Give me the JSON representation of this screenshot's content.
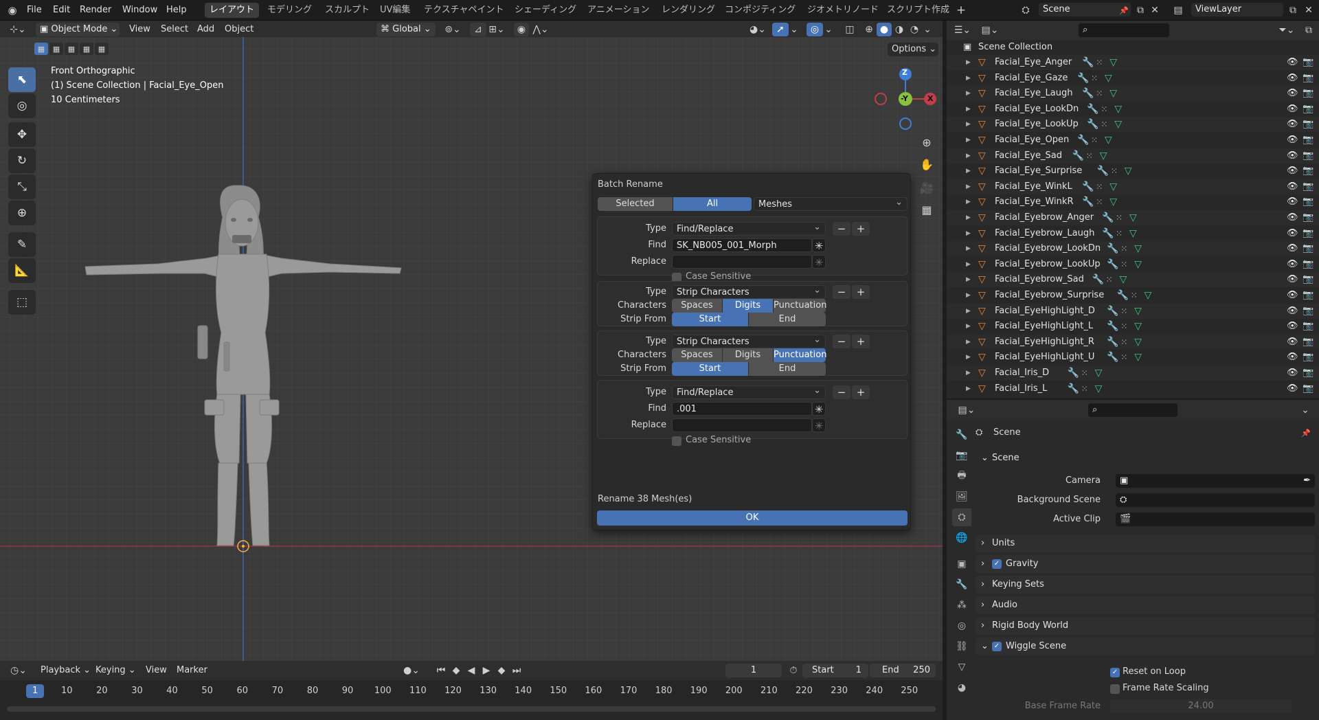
{
  "menu": {
    "file": "File",
    "edit": "Edit",
    "render": "Render",
    "window": "Window",
    "help": "Help"
  },
  "workspaces": [
    "レイアウト",
    "モデリング",
    "スカルプト",
    "UV編集",
    "テクスチャペイント",
    "シェーディング",
    "アニメーション",
    "レンダリング",
    "コンポジティング",
    "ジオメトリノード",
    "スクリプト作成"
  ],
  "active_workspace": 0,
  "scene_name": "Scene",
  "view_layer": "ViewLayer",
  "viewport_header": {
    "mode": "Object Mode",
    "view": "View",
    "select": "Select",
    "add": "Add",
    "object": "Object",
    "orientation": "Global",
    "options": "Options"
  },
  "overlay": {
    "view_name": "Front Orthographic",
    "collection": "(1) Scene Collection | Facial_Eye_Open",
    "scale": "10 Centimeters"
  },
  "gizmo": {
    "z": "Z",
    "y": "-Y",
    "x": "X"
  },
  "dialog": {
    "title": "Batch Rename",
    "scope": {
      "selected": "Selected",
      "all": "All",
      "data_type": "Meshes"
    },
    "op1": {
      "type_label": "Type",
      "type": "Find/Replace",
      "find_label": "Find",
      "find": "SK_NB005_001_Morph",
      "replace_label": "Replace",
      "replace": "",
      "case_label": "Case Sensitive"
    },
    "op2": {
      "type_label": "Type",
      "type": "Strip Characters",
      "chars_label": "Characters",
      "spaces": "Spaces",
      "digits": "Digits",
      "punct": "Punctuation",
      "strip_label": "Strip From",
      "start": "Start",
      "end": "End"
    },
    "op3": {
      "type_label": "Type",
      "type": "Strip Characters",
      "chars_label": "Characters",
      "spaces": "Spaces",
      "digits": "Digits",
      "punct": "Punctuation",
      "strip_label": "Strip From",
      "start": "Start",
      "end": "End"
    },
    "op4": {
      "type_label": "Type",
      "type": "Find/Replace",
      "find_label": "Find",
      "find": ".001",
      "replace_label": "Replace",
      "replace": "",
      "case_label": "Case Sensitive"
    },
    "summary": "Rename 38 Mesh(es)",
    "ok": "OK"
  },
  "outliner": {
    "root": "Scene Collection",
    "items": [
      "Facial_Eye_Anger",
      "Facial_Eye_Gaze",
      "Facial_Eye_Laugh",
      "Facial_Eye_LookDn",
      "Facial_Eye_LookUp",
      "Facial_Eye_Open",
      "Facial_Eye_Sad",
      "Facial_Eye_Surprise",
      "Facial_Eye_WinkL",
      "Facial_Eye_WinkR",
      "Facial_Eyebrow_Anger",
      "Facial_Eyebrow_Laugh",
      "Facial_Eyebrow_LookDn",
      "Facial_Eyebrow_LookUp",
      "Facial_Eyebrow_Sad",
      "Facial_Eyebrow_Surprise",
      "Facial_EyeHighLight_D",
      "Facial_EyeHighLight_L",
      "Facial_EyeHighLight_R",
      "Facial_EyeHighLight_U",
      "Facial_Iris_D",
      "Facial_Iris_L"
    ]
  },
  "properties": {
    "header": "Scene",
    "scene_section": "Scene",
    "camera_label": "Camera",
    "bg_scene_label": "Background Scene",
    "active_clip_label": "Active Clip",
    "units": "Units",
    "gravity": "Gravity",
    "keying_sets": "Keying Sets",
    "audio": "Audio",
    "rigid_body": "Rigid Body World",
    "wiggle": "Wiggle Scene",
    "reset_loop": "Reset on Loop",
    "frame_rate_scaling": "Frame Rate Scaling",
    "base_frame_rate_label": "Base Frame Rate",
    "base_frame_rate": "24.00"
  },
  "timeline": {
    "playback": "Playback",
    "keying": "Keying",
    "view": "View",
    "marker": "Marker",
    "current_frame": "1",
    "start_label": "Start",
    "start": "1",
    "end_label": "End",
    "end": "250",
    "ticks": [
      "1",
      "10",
      "20",
      "30",
      "40",
      "50",
      "60",
      "70",
      "80",
      "90",
      "100",
      "110",
      "120",
      "130",
      "140",
      "150",
      "160",
      "170",
      "180",
      "190",
      "200",
      "210",
      "220",
      "230",
      "240",
      "250"
    ]
  },
  "colors": {
    "accent": "#4772b3",
    "mesh_icon": "#e8863a",
    "x_axis": "#c33e4a",
    "y_axis": "#8bc13b",
    "z_axis": "#3d7fd8"
  }
}
